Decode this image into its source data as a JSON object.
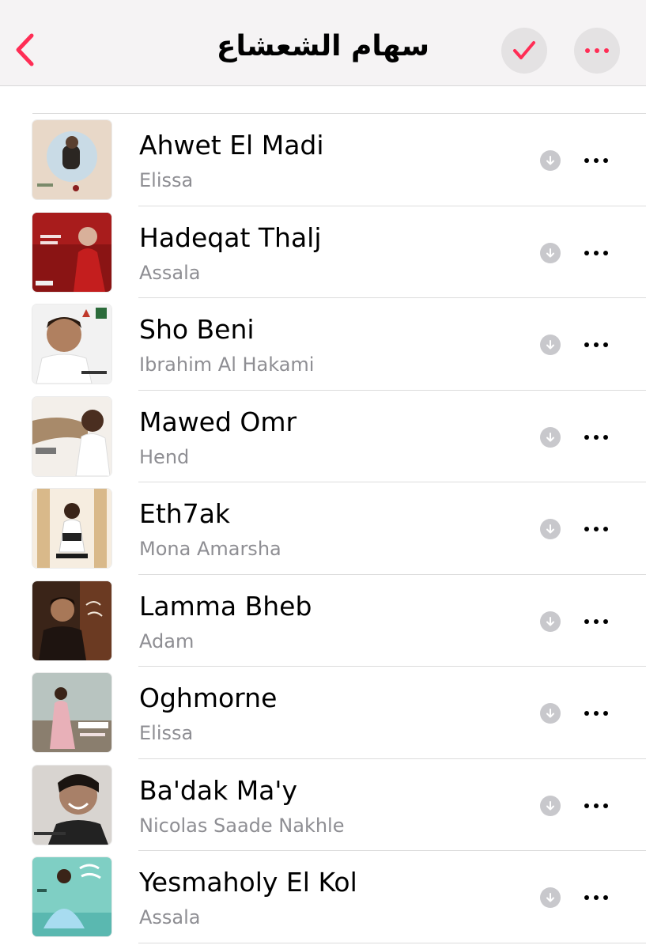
{
  "header": {
    "title": "سهام الشعشاع",
    "back_icon": "chevron-left-icon",
    "check_icon": "checkmark-icon",
    "more_icon": "ellipsis-icon",
    "accent_color": "#ff2d55"
  },
  "songs": [
    {
      "title": "Ahwet El Madi",
      "artist": "Elissa"
    },
    {
      "title": "Hadeqat Thalj",
      "artist": "Assala"
    },
    {
      "title": "Sho Beni",
      "artist": "Ibrahim Al Hakami"
    },
    {
      "title": "Mawed Omr",
      "artist": "Hend"
    },
    {
      "title": "Eth7ak",
      "artist": "Mona Amarsha"
    },
    {
      "title": "Lamma Bheb",
      "artist": "Adam"
    },
    {
      "title": "Oghmorne",
      "artist": "Elissa"
    },
    {
      "title": "Ba'dak Ma'y",
      "artist": "Nicolas Saade Nakhle"
    },
    {
      "title": "Yesmaholy El Kol",
      "artist": "Assala"
    }
  ]
}
